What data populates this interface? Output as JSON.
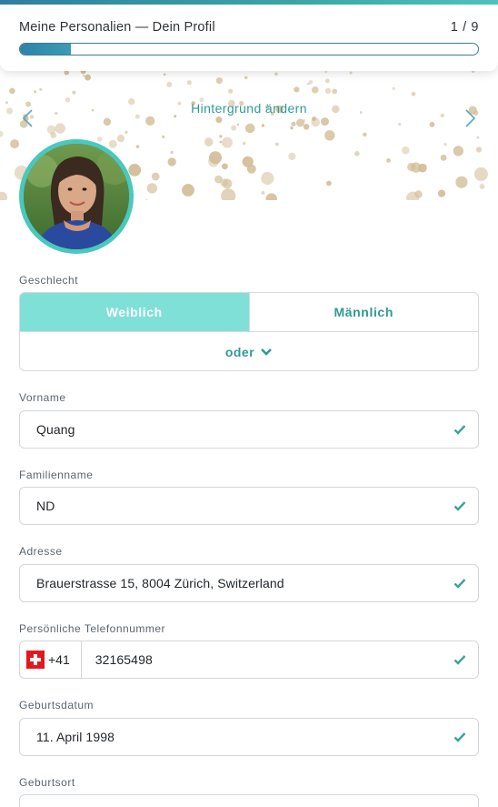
{
  "progress": {
    "title": "Meine Personalien — Dein Profil",
    "step_label": "1 / 9",
    "value_fraction": 0.111
  },
  "banner": {
    "change_background_label": "Hintergrund ändern",
    "prev_icon": "chevron-left-icon",
    "next_icon": "chevron-right-icon",
    "dot_color": "#d2bc96"
  },
  "avatar": {
    "ring_color": "#49c9bd"
  },
  "gender": {
    "label": "Geschlecht",
    "options": [
      "Weiblich",
      "Männlich"
    ],
    "selected": "Weiblich",
    "more_label": "oder",
    "more_icon": "chevron-down-icon"
  },
  "fields": {
    "first_name": {
      "label": "Vorname",
      "value": "Quang"
    },
    "last_name": {
      "label": "Familienname",
      "value": "ND"
    },
    "address": {
      "label": "Adresse",
      "value": "Brauerstrasse 15, 8004 Zürich, Switzerland"
    },
    "phone": {
      "label": "Persönliche Telefonnummer",
      "country_code": "+41",
      "flag_icon": "swiss-flag-icon",
      "value": "32165498"
    },
    "birthdate": {
      "label": "Geburtsdatum",
      "value": "11. April 1998"
    },
    "birthplace": {
      "label": "Geburtsort",
      "value": ""
    }
  },
  "colors": {
    "accent": "#2f9a93",
    "selected_bg": "#7fe0d8",
    "check": "#3aa39c",
    "progress_fill": "#2e82a8"
  }
}
